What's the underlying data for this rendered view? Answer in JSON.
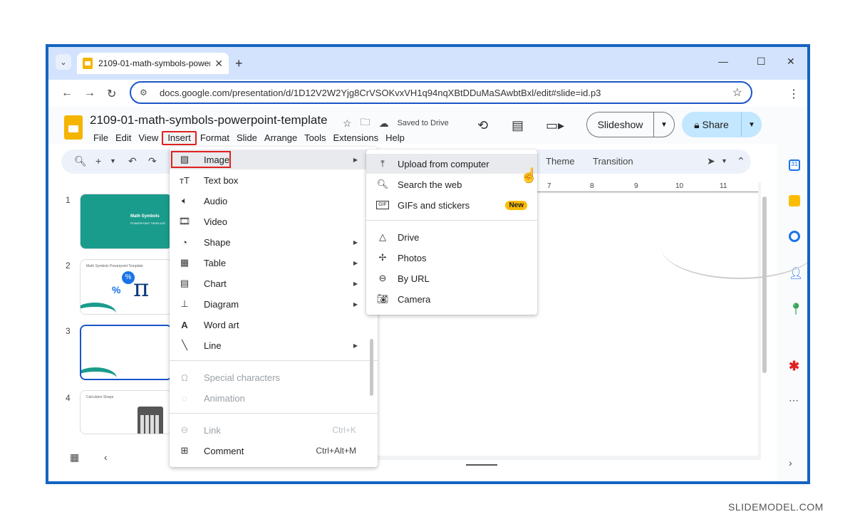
{
  "browser": {
    "tab_title": "2109-01-math-symbols-powerp",
    "new_tab": "+",
    "url": "docs.google.com/presentation/d/1D12V2W2Yjg8CrVSOKvxVH1q94nqXBtDDuMaSAwbtBxl/edit#slide=id.p3"
  },
  "doc": {
    "title": "2109-01-math-symbols-powerpoint-template",
    "saved": "Saved to Drive"
  },
  "menubar": [
    "File",
    "Edit",
    "View",
    "Insert",
    "Format",
    "Slide",
    "Arrange",
    "Tools",
    "Extensions",
    "Help"
  ],
  "header": {
    "slideshow": "Slideshow",
    "share": "Share"
  },
  "toolbar": {
    "theme": "Theme",
    "transition": "Transition"
  },
  "ruler": [
    "7",
    "8",
    "9",
    "10",
    "11"
  ],
  "slides": [
    {
      "num": "1",
      "title": "Math Symbols",
      "sub": "POWERPOINT TEMPLATE"
    },
    {
      "num": "2",
      "title": "Math Symbols Powerpoint Template",
      "pi": "π",
      "pct": "%"
    },
    {
      "num": "3"
    },
    {
      "num": "4",
      "title": "Calculator Shape"
    }
  ],
  "insert_menu": {
    "image": "Image",
    "text_box": "Text box",
    "audio": "Audio",
    "video": "Video",
    "shape": "Shape",
    "table": "Table",
    "chart": "Chart",
    "diagram": "Diagram",
    "word_art": "Word art",
    "line": "Line",
    "special_characters": "Special characters",
    "animation": "Animation",
    "link": "Link",
    "link_shortcut": "Ctrl+K",
    "comment": "Comment",
    "comment_shortcut": "Ctrl+Alt+M"
  },
  "image_menu": {
    "upload": "Upload from computer",
    "search": "Search the web",
    "gifs": "GIFs and stickers",
    "new_badge": "New",
    "drive": "Drive",
    "photos": "Photos",
    "by_url": "By URL",
    "camera": "Camera"
  },
  "watermark": "SLIDEMODEL.COM",
  "colors": {
    "frame": "#1464c0",
    "accent": "#1a55c8",
    "highlight": "#e02020",
    "share_bg": "#c2e7ff",
    "badge": "#fbbc04"
  }
}
